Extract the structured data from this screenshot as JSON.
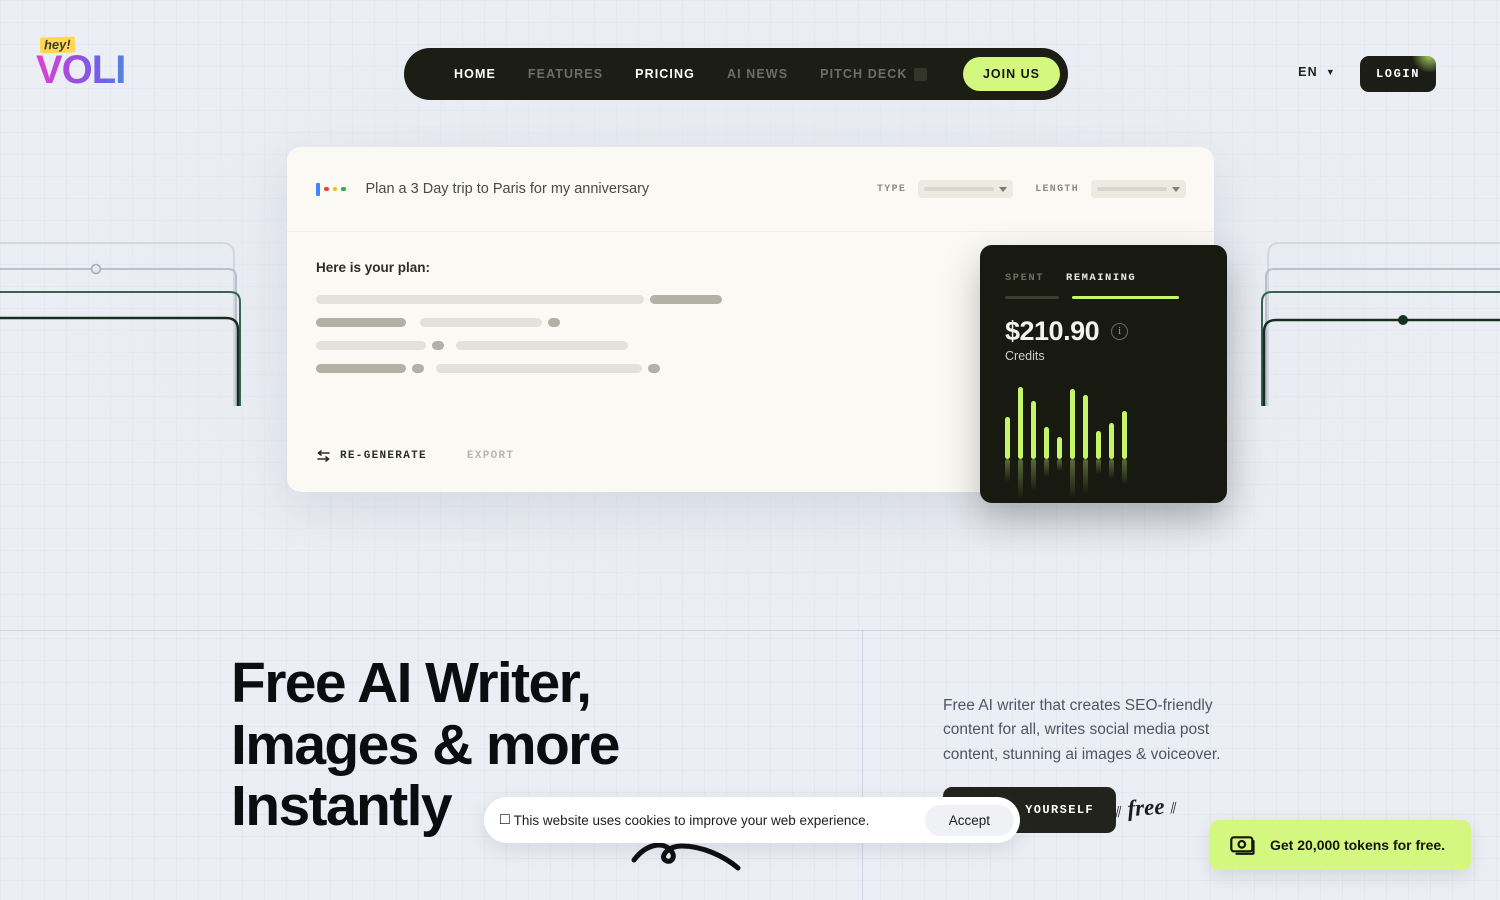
{
  "brand": {
    "tagline": "hey!",
    "name": "VOLI"
  },
  "nav": {
    "items": [
      {
        "label": "HOME",
        "active": true,
        "badge": false
      },
      {
        "label": "FEATURES",
        "active": false,
        "badge": false
      },
      {
        "label": "PRICING",
        "active": true,
        "badge": false
      },
      {
        "label": "AI NEWS",
        "active": false,
        "badge": false
      },
      {
        "label": "PITCH DECK",
        "active": false,
        "badge": true
      }
    ],
    "join_label": "JOIN US",
    "language": "EN",
    "login_label": "LOGIN"
  },
  "hero_card": {
    "prompt": "Plan a 3 Day trip to Paris for my anniversary",
    "type_label": "TYPE",
    "length_label": "LENGTH",
    "plan_title": "Here is your plan:",
    "regenerate_label": "RE-GENERATE",
    "export_label": "EXPORT"
  },
  "credits": {
    "tab_spent": "SPENT",
    "tab_remaining": "REMAINING",
    "amount": "$210.90",
    "label": "Credits",
    "info_glyph": "i",
    "accent_color": "#c7f56a",
    "bar_values": [
      42,
      72,
      58,
      32,
      22,
      70,
      64,
      28,
      36,
      48
    ]
  },
  "main": {
    "headline": "Free AI Writer,\nImages & more\nInstantly",
    "description": "Free AI writer that creates SEO-friendly content for all, writes social media post content, stunning ai images & voiceover.",
    "cta_label": "TRY IT YOURSELF",
    "free_note": "free"
  },
  "cookie": {
    "emoji": "□",
    "message": "This website uses cookies to improve your web experience.",
    "accept_label": "Accept"
  },
  "toast": {
    "message": "Get 20,000 tokens for free.",
    "background": "#d4f77f"
  }
}
